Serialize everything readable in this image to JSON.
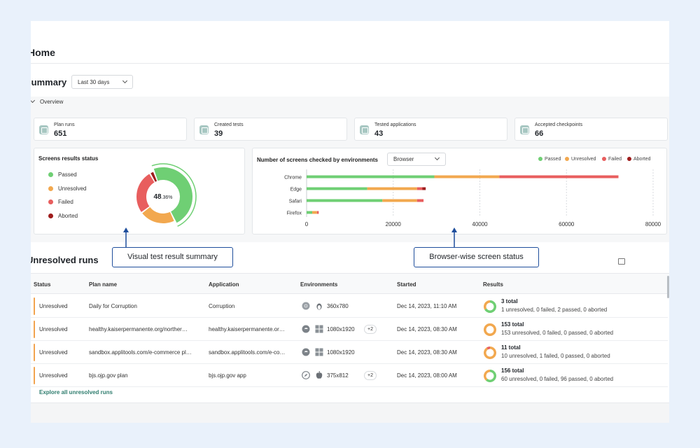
{
  "page": {
    "title": "Home"
  },
  "summary": {
    "title": "Summary",
    "range": "Last 30 days",
    "overview_label": "Overview",
    "stats": [
      {
        "label": "Plan runs",
        "value": "651"
      },
      {
        "label": "Created tests",
        "value": "39"
      },
      {
        "label": "Tested applications",
        "value": "43"
      },
      {
        "label": "Accepted checkpoints",
        "value": "66"
      }
    ]
  },
  "screens_status": {
    "title": "Screens results status",
    "legend": [
      "Passed",
      "Unresolved",
      "Failed",
      "Aborted"
    ],
    "center_big": "48",
    "center_small": ".36%"
  },
  "env_chart": {
    "title": "Number of screens checked by environments",
    "select": "Browser",
    "legend": [
      "Passed",
      "Unresolved",
      "Failed",
      "Aborted"
    ]
  },
  "colors": {
    "passed": "#6fcf74",
    "unresolved": "#f2a84f",
    "failed": "#e85e5e",
    "aborted": "#9e1c1c",
    "accent": "#1f4e9c",
    "link": "#2f7d6e"
  },
  "chart_data": [
    {
      "type": "pie",
      "title": "Screens results status",
      "labels": [
        "Passed",
        "Unresolved",
        "Failed",
        "Aborted"
      ],
      "values": [
        48.36,
        22,
        27,
        2.64
      ],
      "center_label": "48.36%"
    },
    {
      "type": "bar",
      "orientation": "horizontal",
      "stacked": true,
      "title": "Number of screens checked by environments",
      "categories": [
        "Chrome",
        "Edge",
        "Safari",
        "Firefox"
      ],
      "series": [
        {
          "name": "Passed",
          "values": [
            29500,
            14000,
            17500,
            1300
          ]
        },
        {
          "name": "Unresolved",
          "values": [
            15000,
            11500,
            8000,
            1100
          ]
        },
        {
          "name": "Failed",
          "values": [
            27500,
            1200,
            1500,
            400
          ]
        },
        {
          "name": "Aborted",
          "values": [
            0,
            800,
            0,
            0
          ]
        }
      ],
      "xticks": [
        "0",
        "20000",
        "40000",
        "60000",
        "80000"
      ],
      "xlim": [
        0,
        80000
      ],
      "legend_position": "top-right"
    }
  ],
  "callouts": {
    "left": "Visual test result summary",
    "right": "Browser-wise screen status"
  },
  "unresolved": {
    "title": "Unresolved runs",
    "columns": [
      "Status",
      "Plan name",
      "Application",
      "Environments",
      "Started",
      "Results"
    ],
    "rows": [
      {
        "status": "Unresolved",
        "plan": "Daily for Corruption",
        "app": "Corruption",
        "env_icons": [
          "chrome-icon",
          "linux-icon"
        ],
        "res": "360x780",
        "extra": "",
        "started": "Dec 14, 2023, 11:10 AM",
        "total": "3 total",
        "detail": "1 unresolved, 0 failed, 2 passed, 0 aborted",
        "ring": [
          2,
          1,
          0
        ]
      },
      {
        "status": "Unresolved",
        "plan": "healthy.kaiserpermanente.org/norther…",
        "app": "healthy.kaiserpermanente.or…",
        "env_icons": [
          "edge-icon",
          "windows-icon"
        ],
        "res": "1080x1920",
        "extra": "+2",
        "started": "Dec 14, 2023, 08:30 AM",
        "total": "153 total",
        "detail": "153 unresolved, 0 failed, 0 passed, 0 aborted",
        "ring": [
          0,
          153,
          0
        ]
      },
      {
        "status": "Unresolved",
        "plan": "sandbox.applitools.com/e-commerce pl…",
        "app": "sandbox.applitools.com/e-co…",
        "env_icons": [
          "edge-icon",
          "windows-icon"
        ],
        "res": "1080x1920",
        "extra": "",
        "started": "Dec 14, 2023, 08:30 AM",
        "total": "11 total",
        "detail": "10 unresolved, 1 failed, 0 passed, 0 aborted",
        "ring": [
          0,
          10,
          1
        ]
      },
      {
        "status": "Unresolved",
        "plan": "bjs.ojp.gov plan",
        "app": "bjs.ojp.gov app",
        "env_icons": [
          "safari-icon",
          "apple-icon"
        ],
        "res": "375x812",
        "extra": "+2",
        "started": "Dec 14, 2023, 08:00 AM",
        "total": "156 total",
        "detail": "60 unresolved, 0 failed, 96 passed, 0 aborted",
        "ring": [
          96,
          60,
          0
        ]
      }
    ],
    "explore_link": "Explore all unresolved runs"
  }
}
